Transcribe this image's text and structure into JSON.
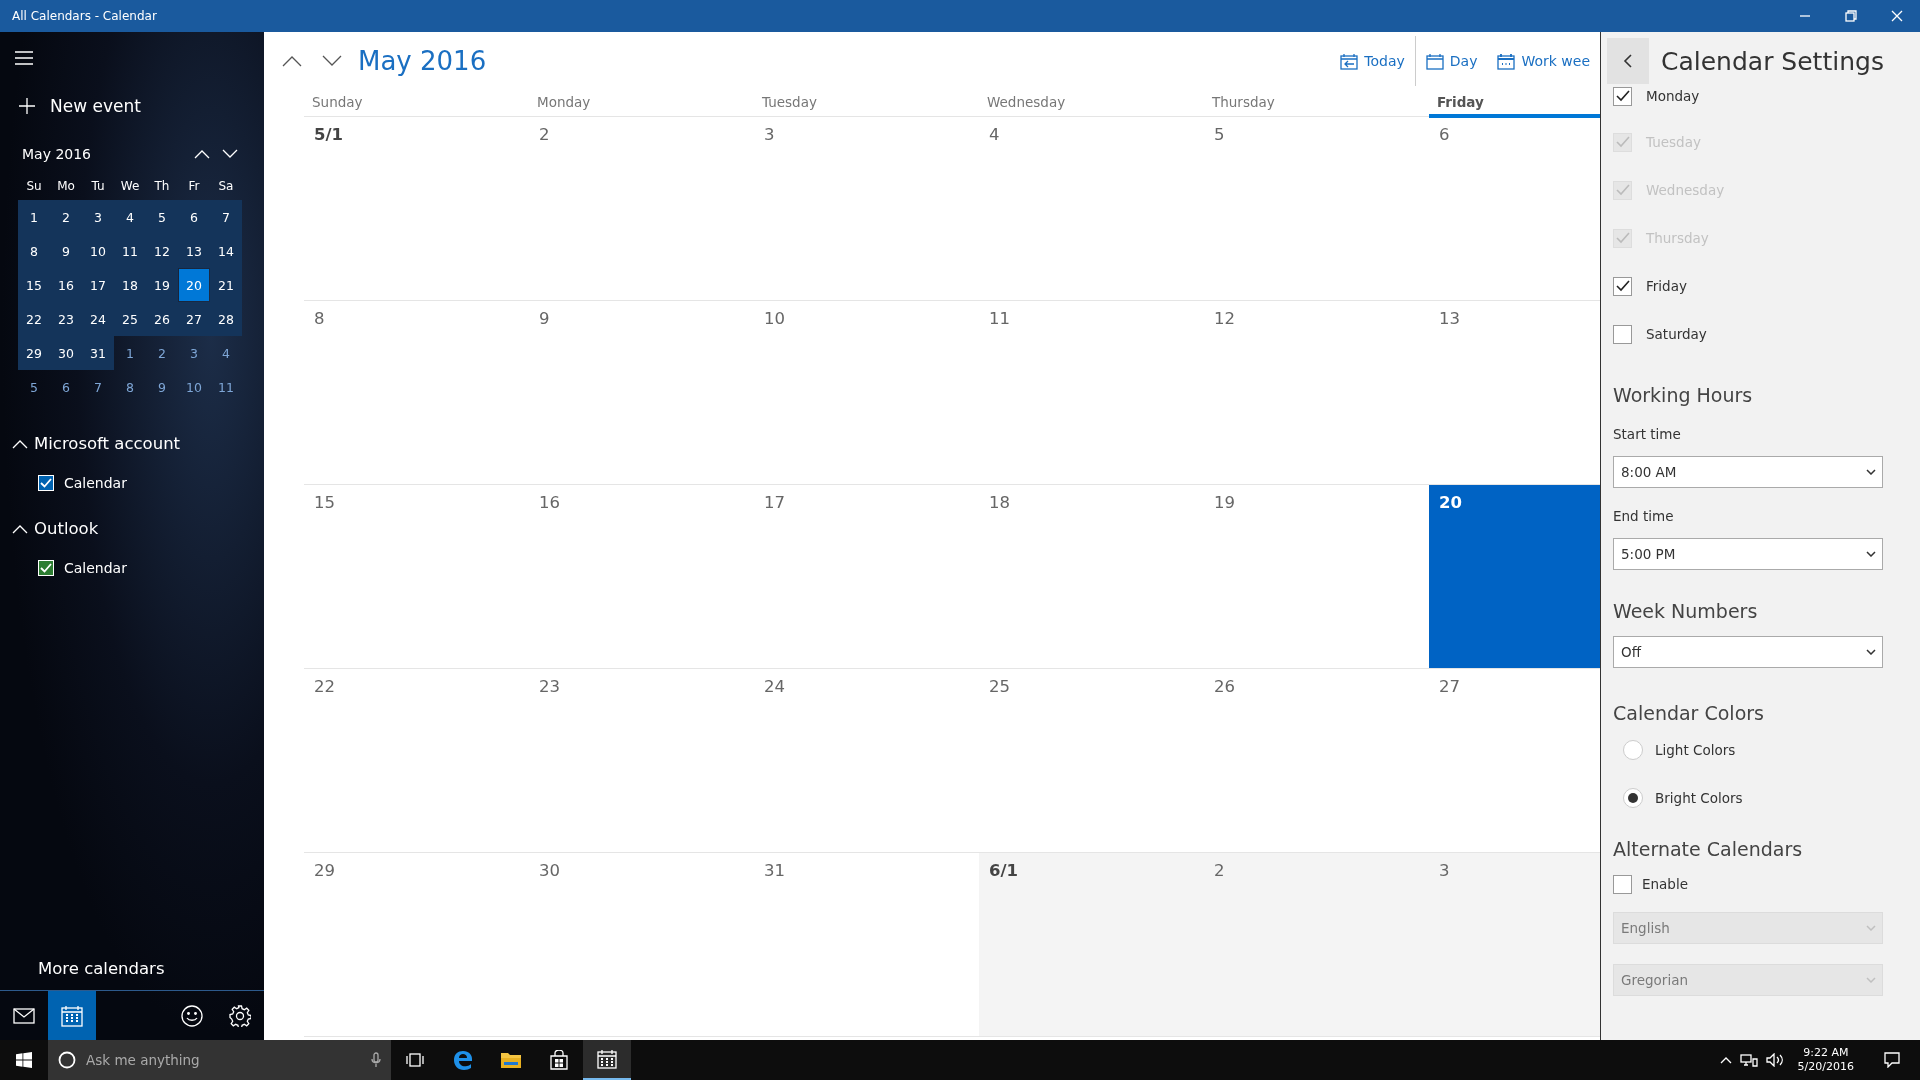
{
  "window": {
    "title": "All Calendars - Calendar"
  },
  "sidebar": {
    "new_event": "New event",
    "mini_calendar": {
      "title": "May 2016",
      "weekdays": [
        "Su",
        "Mo",
        "Tu",
        "We",
        "Th",
        "Fr",
        "Sa"
      ],
      "weeks": [
        [
          {
            "label": "1",
            "kind": "in",
            "selected": false
          },
          {
            "label": "2",
            "kind": "in",
            "selected": false
          },
          {
            "label": "3",
            "kind": "in",
            "selected": false
          },
          {
            "label": "4",
            "kind": "in",
            "selected": false
          },
          {
            "label": "5",
            "kind": "in",
            "selected": false
          },
          {
            "label": "6",
            "kind": "in",
            "selected": false
          },
          {
            "label": "7",
            "kind": "in",
            "selected": false
          }
        ],
        [
          {
            "label": "8",
            "kind": "in",
            "selected": false
          },
          {
            "label": "9",
            "kind": "in",
            "selected": false
          },
          {
            "label": "10",
            "kind": "in",
            "selected": false
          },
          {
            "label": "11",
            "kind": "in",
            "selected": false
          },
          {
            "label": "12",
            "kind": "in",
            "selected": false
          },
          {
            "label": "13",
            "kind": "in",
            "selected": false
          },
          {
            "label": "14",
            "kind": "in",
            "selected": false
          }
        ],
        [
          {
            "label": "15",
            "kind": "in",
            "selected": false
          },
          {
            "label": "16",
            "kind": "in",
            "selected": false
          },
          {
            "label": "17",
            "kind": "in",
            "selected": false
          },
          {
            "label": "18",
            "kind": "in",
            "selected": false
          },
          {
            "label": "19",
            "kind": "in",
            "selected": false
          },
          {
            "label": "20",
            "kind": "in",
            "selected": true
          },
          {
            "label": "21",
            "kind": "in",
            "selected": false
          }
        ],
        [
          {
            "label": "22",
            "kind": "in",
            "selected": false
          },
          {
            "label": "23",
            "kind": "in",
            "selected": false
          },
          {
            "label": "24",
            "kind": "in",
            "selected": false
          },
          {
            "label": "25",
            "kind": "in",
            "selected": false
          },
          {
            "label": "26",
            "kind": "in",
            "selected": false
          },
          {
            "label": "27",
            "kind": "in",
            "selected": false
          },
          {
            "label": "28",
            "kind": "in",
            "selected": false
          }
        ],
        [
          {
            "label": "29",
            "kind": "in",
            "selected": false
          },
          {
            "label": "30",
            "kind": "in",
            "selected": false
          },
          {
            "label": "31",
            "kind": "in",
            "selected": false
          },
          {
            "label": "1",
            "kind": "out",
            "selected": false
          },
          {
            "label": "2",
            "kind": "out",
            "selected": false
          },
          {
            "label": "3",
            "kind": "out",
            "selected": false
          },
          {
            "label": "4",
            "kind": "out",
            "selected": false
          }
        ],
        [
          {
            "label": "5",
            "kind": "out",
            "selected": false
          },
          {
            "label": "6",
            "kind": "out",
            "selected": false
          },
          {
            "label": "7",
            "kind": "out",
            "selected": false
          },
          {
            "label": "8",
            "kind": "out",
            "selected": false
          },
          {
            "label": "9",
            "kind": "out",
            "selected": false
          },
          {
            "label": "10",
            "kind": "out",
            "selected": false
          },
          {
            "label": "11",
            "kind": "out",
            "selected": false
          }
        ]
      ]
    },
    "accounts": [
      {
        "name": "Microsoft account",
        "expanded": true,
        "calendars": [
          {
            "name": "Calendar",
            "checked": true,
            "color": "#0063b1"
          }
        ]
      },
      {
        "name": "Outlook",
        "expanded": true,
        "calendars": [
          {
            "name": "Calendar",
            "checked": true,
            "color": "#2d7d32"
          }
        ]
      }
    ],
    "more_calendars": "More calendars",
    "nav": [
      {
        "kind": "mail",
        "selected": false
      },
      {
        "kind": "calendar",
        "selected": true
      },
      {
        "kind": "feedback",
        "selected": false
      },
      {
        "kind": "settings",
        "selected": false
      }
    ]
  },
  "header": {
    "month": "May 2016",
    "views": [
      {
        "label": "Today",
        "kind": "today"
      },
      {
        "label": "Day",
        "kind": "day"
      },
      {
        "label": "Work wee",
        "kind": "workweek"
      }
    ]
  },
  "month_grid": {
    "columns": [
      {
        "label": "Sunday",
        "selected": false
      },
      {
        "label": "Monday",
        "selected": false
      },
      {
        "label": "Tuesday",
        "selected": false
      },
      {
        "label": "Wednesday",
        "selected": false
      },
      {
        "label": "Thursday",
        "selected": false
      },
      {
        "label": "Friday",
        "selected": true
      }
    ],
    "weeks": [
      [
        {
          "label": "5/1",
          "kind": "in",
          "month_start": true,
          "selected": false
        },
        {
          "label": "2",
          "kind": "in",
          "month_start": false,
          "selected": false
        },
        {
          "label": "3",
          "kind": "in",
          "month_start": false,
          "selected": false
        },
        {
          "label": "4",
          "kind": "in",
          "month_start": false,
          "selected": false
        },
        {
          "label": "5",
          "kind": "in",
          "month_start": false,
          "selected": false
        },
        {
          "label": "6",
          "kind": "in",
          "month_start": false,
          "selected": false
        }
      ],
      [
        {
          "label": "8",
          "kind": "in",
          "month_start": false,
          "selected": false
        },
        {
          "label": "9",
          "kind": "in",
          "month_start": false,
          "selected": false
        },
        {
          "label": "10",
          "kind": "in",
          "month_start": false,
          "selected": false
        },
        {
          "label": "11",
          "kind": "in",
          "month_start": false,
          "selected": false
        },
        {
          "label": "12",
          "kind": "in",
          "month_start": false,
          "selected": false
        },
        {
          "label": "13",
          "kind": "in",
          "month_start": false,
          "selected": false
        }
      ],
      [
        {
          "label": "15",
          "kind": "in",
          "month_start": false,
          "selected": false
        },
        {
          "label": "16",
          "kind": "in",
          "month_start": false,
          "selected": false
        },
        {
          "label": "17",
          "kind": "in",
          "month_start": false,
          "selected": false
        },
        {
          "label": "18",
          "kind": "in",
          "month_start": false,
          "selected": false
        },
        {
          "label": "19",
          "kind": "in",
          "month_start": false,
          "selected": false
        },
        {
          "label": "20",
          "kind": "in",
          "month_start": false,
          "selected": true
        }
      ],
      [
        {
          "label": "22",
          "kind": "in",
          "month_start": false,
          "selected": false
        },
        {
          "label": "23",
          "kind": "in",
          "month_start": false,
          "selected": false
        },
        {
          "label": "24",
          "kind": "in",
          "month_start": false,
          "selected": false
        },
        {
          "label": "25",
          "kind": "in",
          "month_start": false,
          "selected": false
        },
        {
          "label": "26",
          "kind": "in",
          "month_start": false,
          "selected": false
        },
        {
          "label": "27",
          "kind": "in",
          "month_start": false,
          "selected": false
        }
      ],
      [
        {
          "label": "29",
          "kind": "in",
          "month_start": false,
          "selected": false
        },
        {
          "label": "30",
          "kind": "in",
          "month_start": false,
          "selected": false
        },
        {
          "label": "31",
          "kind": "in",
          "month_start": false,
          "selected": false
        },
        {
          "label": "6/1",
          "kind": "out",
          "month_start": true,
          "selected": false
        },
        {
          "label": "2",
          "kind": "out",
          "month_start": false,
          "selected": false
        },
        {
          "label": "3",
          "kind": "out",
          "month_start": false,
          "selected": false
        }
      ]
    ]
  },
  "settings": {
    "title": "Calendar Settings",
    "work_days": [
      {
        "label": "Monday",
        "checked": true,
        "disabled": false
      },
      {
        "label": "Tuesday",
        "checked": true,
        "disabled": true
      },
      {
        "label": "Wednesday",
        "checked": true,
        "disabled": true
      },
      {
        "label": "Thursday",
        "checked": true,
        "disabled": true
      },
      {
        "label": "Friday",
        "checked": true,
        "disabled": false
      },
      {
        "label": "Saturday",
        "checked": false,
        "disabled": false
      }
    ],
    "working_hours": {
      "heading": "Working Hours",
      "start_label": "Start time",
      "start_value": "8:00 AM",
      "end_label": "End time",
      "end_value": "5:00 PM"
    },
    "week_numbers": {
      "heading": "Week Numbers",
      "value": "Off"
    },
    "calendar_colors": {
      "heading": "Calendar Colors",
      "options": [
        {
          "label": "Light Colors",
          "selected": false
        },
        {
          "label": "Bright Colors",
          "selected": true
        }
      ]
    },
    "alternate_calendars": {
      "heading": "Alternate Calendars",
      "enable": {
        "label": "Enable",
        "checked": false
      },
      "dropdowns": [
        {
          "value": "English",
          "disabled": true
        },
        {
          "value": "Gregorian",
          "disabled": true
        }
      ]
    }
  },
  "taskbar": {
    "search_placeholder": "Ask me anything",
    "apps": [
      {
        "kind": "task_view",
        "selected": false
      },
      {
        "kind": "edge",
        "selected": false
      },
      {
        "kind": "explorer",
        "selected": false
      },
      {
        "kind": "store",
        "selected": false
      },
      {
        "kind": "calendar",
        "selected": true
      }
    ],
    "time": "9:22 AM",
    "date": "5/20/2016"
  }
}
